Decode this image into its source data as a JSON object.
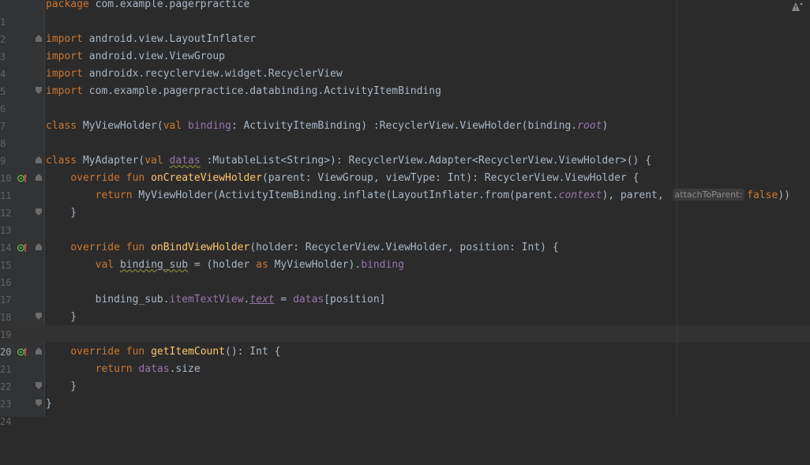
{
  "editor": {
    "line_numbers": [
      "1",
      "2",
      "3",
      "4",
      "5",
      "6",
      "7",
      "8",
      "9",
      "10",
      "11",
      "12",
      "13",
      "14",
      "15",
      "16",
      "17",
      "18",
      "19",
      "20",
      "21",
      "22",
      "23",
      "24"
    ],
    "current_line": "20",
    "line1": {
      "kw_package": "package",
      "pkg": " com.example.pagerpractice"
    },
    "line3": {
      "kw": "import",
      "path": " android.view.LayoutInflater"
    },
    "line4": {
      "kw": "import",
      "path": " android.view.ViewGroup"
    },
    "line5": {
      "kw": "import",
      "path": " androidx.recyclerview.widget.RecyclerView"
    },
    "line6": {
      "kw": "import",
      "path": " com.example.pagerpractice.databinding.ActivityItemBinding"
    },
    "line8": {
      "kw_class": "class",
      "name": " MyViewHolder(",
      "kw_val": "val",
      "param": " binding",
      "rest": ": ActivityItemBinding) :RecyclerView.ViewHolder(binding.",
      "root": "root",
      "close": ")"
    },
    "line10": {
      "kw_class": "class",
      "name": " MyAdapter(",
      "kw_val": "val",
      "sp": " ",
      "param": "datas",
      "rest": " :MutableList<String>): RecyclerView.Adapter<RecyclerView.ViewHolder>() {"
    },
    "line11": {
      "indent": "    ",
      "kw_override": "override",
      "sp1": " ",
      "kw_fun": "fun",
      "sp2": " ",
      "fn": "onCreateViewHolder",
      "rest": "(parent: ViewGroup, viewType: Int): RecyclerView.ViewHolder {"
    },
    "line12": {
      "indent": "        ",
      "kw_return": "return",
      "a": " MyViewHolder(ActivityItemBinding.inflate(LayoutInflater.from(parent.",
      "ctx": "context",
      "b": "), parent, ",
      "hint": "attachToParent:",
      "kw_false": "false",
      "c": "))"
    },
    "line13": {
      "text": "    }"
    },
    "line15": {
      "indent": "    ",
      "kw_override": "override",
      "sp1": " ",
      "kw_fun": "fun",
      "sp2": " ",
      "fn": "onBindViewHolder",
      "rest": "(holder: RecyclerView.ViewHolder, position: Int) {"
    },
    "line16": {
      "indent": "        ",
      "kw_val": "val",
      "sp": " ",
      "var": "binding_sub",
      "a": " = (holder ",
      "kw_as": "as",
      "b": " MyViewHolder).",
      "prop": "binding"
    },
    "line18": {
      "indent": "        ",
      "a": "binding_sub.",
      "view": "itemTextView",
      "dot": ".",
      "text": "text",
      "b": " = ",
      "datas": "datas",
      "c": "[position]"
    },
    "line19": {
      "text": "    }"
    },
    "line21": {
      "indent": "    ",
      "kw_override": "override",
      "sp1": " ",
      "kw_fun": "fun",
      "sp2": " ",
      "fn": "getItemCount",
      "rest": "(): Int {"
    },
    "line22": {
      "indent": "        ",
      "kw_return": "return",
      "sp": " ",
      "datas": "datas",
      "rest": ".size"
    },
    "line23": {
      "text": "    }"
    },
    "line24": {
      "text": "}"
    }
  },
  "icons": {
    "override": "override-gutter-icon",
    "warning": "warning-icon",
    "fold": "fold-marker-icon"
  },
  "colors": {
    "background": "#2b2b2b",
    "gutter": "#313335",
    "keyword": "#cc7832",
    "function": "#ffc66d",
    "property": "#9876aa",
    "text": "#a9b7c6",
    "line_number": "#606366"
  }
}
